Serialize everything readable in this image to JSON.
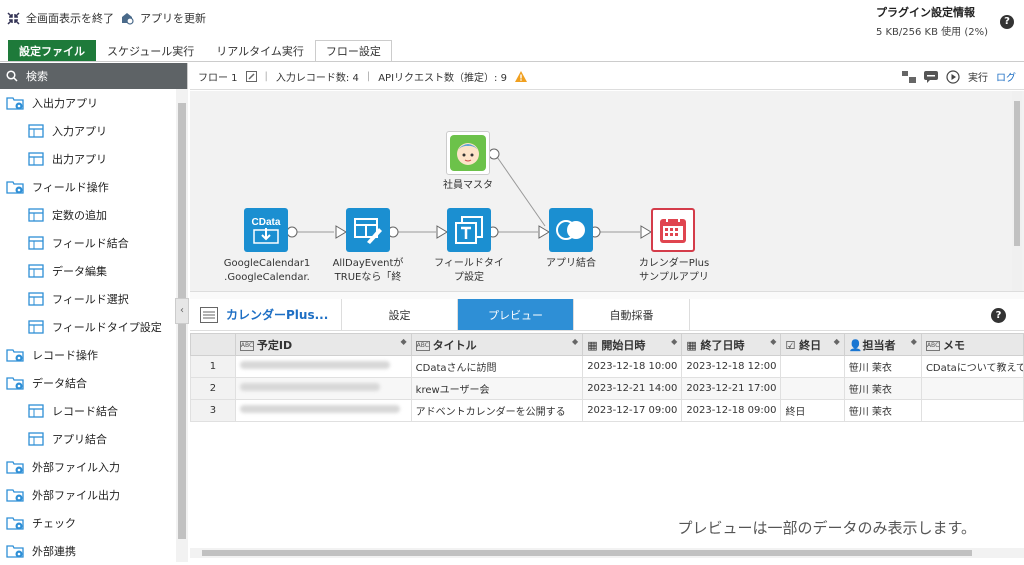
{
  "topbar": {
    "exit_fullscreen": "全画面表示を終了",
    "update_app": "アプリを更新",
    "plugin_title": "プラグイン設定情報",
    "plugin_usage": "5 KB/256 KB 使用 (2%)",
    "help": "?"
  },
  "tabs": [
    "設定ファイル",
    "スケジュール実行",
    "リアルタイム実行",
    "フロー設定"
  ],
  "sidebar": {
    "search_placeholder": "検索",
    "items": [
      {
        "label": "入出力アプリ",
        "level": "cat",
        "icon": "folder-gear-icon"
      },
      {
        "label": "入力アプリ",
        "level": "sub",
        "icon": "input-app-icon"
      },
      {
        "label": "出力アプリ",
        "level": "sub",
        "icon": "output-app-icon"
      },
      {
        "label": "フィールド操作",
        "level": "cat",
        "icon": "folder-gear-icon"
      },
      {
        "label": "定数の追加",
        "level": "sub",
        "icon": "add-constant-icon"
      },
      {
        "label": "フィールド結合",
        "level": "sub",
        "icon": "field-join-icon"
      },
      {
        "label": "データ編集",
        "level": "sub",
        "icon": "data-edit-icon"
      },
      {
        "label": "フィールド選択",
        "level": "sub",
        "icon": "field-select-icon"
      },
      {
        "label": "フィールドタイプ設定",
        "level": "sub",
        "icon": "field-type-icon"
      },
      {
        "label": "レコード操作",
        "level": "cat",
        "icon": "folder-gear-icon"
      },
      {
        "label": "データ結合",
        "level": "cat",
        "icon": "folder-gear-icon"
      },
      {
        "label": "レコード結合",
        "level": "sub",
        "icon": "record-join-icon"
      },
      {
        "label": "アプリ結合",
        "level": "sub",
        "icon": "app-join-icon"
      },
      {
        "label": "外部ファイル入力",
        "level": "cat",
        "icon": "folder-gear-icon"
      },
      {
        "label": "外部ファイル出力",
        "level": "cat",
        "icon": "folder-gear-icon"
      },
      {
        "label": "チェック",
        "level": "cat",
        "icon": "folder-gear-icon"
      },
      {
        "label": "外部連携",
        "level": "cat",
        "icon": "folder-gear-icon"
      }
    ]
  },
  "flowbar": {
    "flow_name": "フロー 1",
    "record_count": "入力レコード数: 4",
    "api_requests": "APIリクエスト数（推定）: 9",
    "run": "実行",
    "log": "ログ"
  },
  "nodes": {
    "n1": [
      "GoogleCalendar1",
      ".GoogleCalendar."
    ],
    "n2": [
      "AllDayEventが",
      "TRUEなら「終"
    ],
    "n3": [
      "フィールドタイ",
      "プ設定"
    ],
    "n4": [
      "アプリ結合"
    ],
    "n5": [
      "カレンダーPlus",
      "サンプルアプリ"
    ],
    "n6": [
      "社員マスタ"
    ],
    "cdata_label": "CData"
  },
  "bottom": {
    "title": "カレンダーPlus...",
    "tabs": [
      "設定",
      "プレビュー",
      "自動採番"
    ],
    "help": "?",
    "note": "プレビューは一部のデータのみ表示します。"
  },
  "table": {
    "headers": [
      "予定ID",
      "タイトル",
      "開始日時",
      "終了日時",
      "終日",
      "担当者",
      "メモ"
    ],
    "rows": [
      {
        "num": "1",
        "title": "CDataさんに訪問",
        "start": "2023-12-18 10:00",
        "end": "2023-12-18 12:00",
        "allday": "",
        "person": "笹川 茉衣",
        "memo": "CDataについて教えて"
      },
      {
        "num": "2",
        "title": "krewユーザー会",
        "start": "2023-12-21 14:00",
        "end": "2023-12-21 17:00",
        "allday": "",
        "person": "笹川 茉衣",
        "memo": ""
      },
      {
        "num": "3",
        "title": "アドベントカレンダーを公開する",
        "start": "2023-12-17 09:00",
        "end": "2023-12-18 09:00",
        "allday": "終日",
        "person": "笹川 茉衣",
        "memo": ""
      }
    ]
  },
  "colors": {
    "green_tab": "#1e7a3a",
    "accent_blue": "#1b8fd1",
    "active_tab": "#2e8fd6"
  }
}
